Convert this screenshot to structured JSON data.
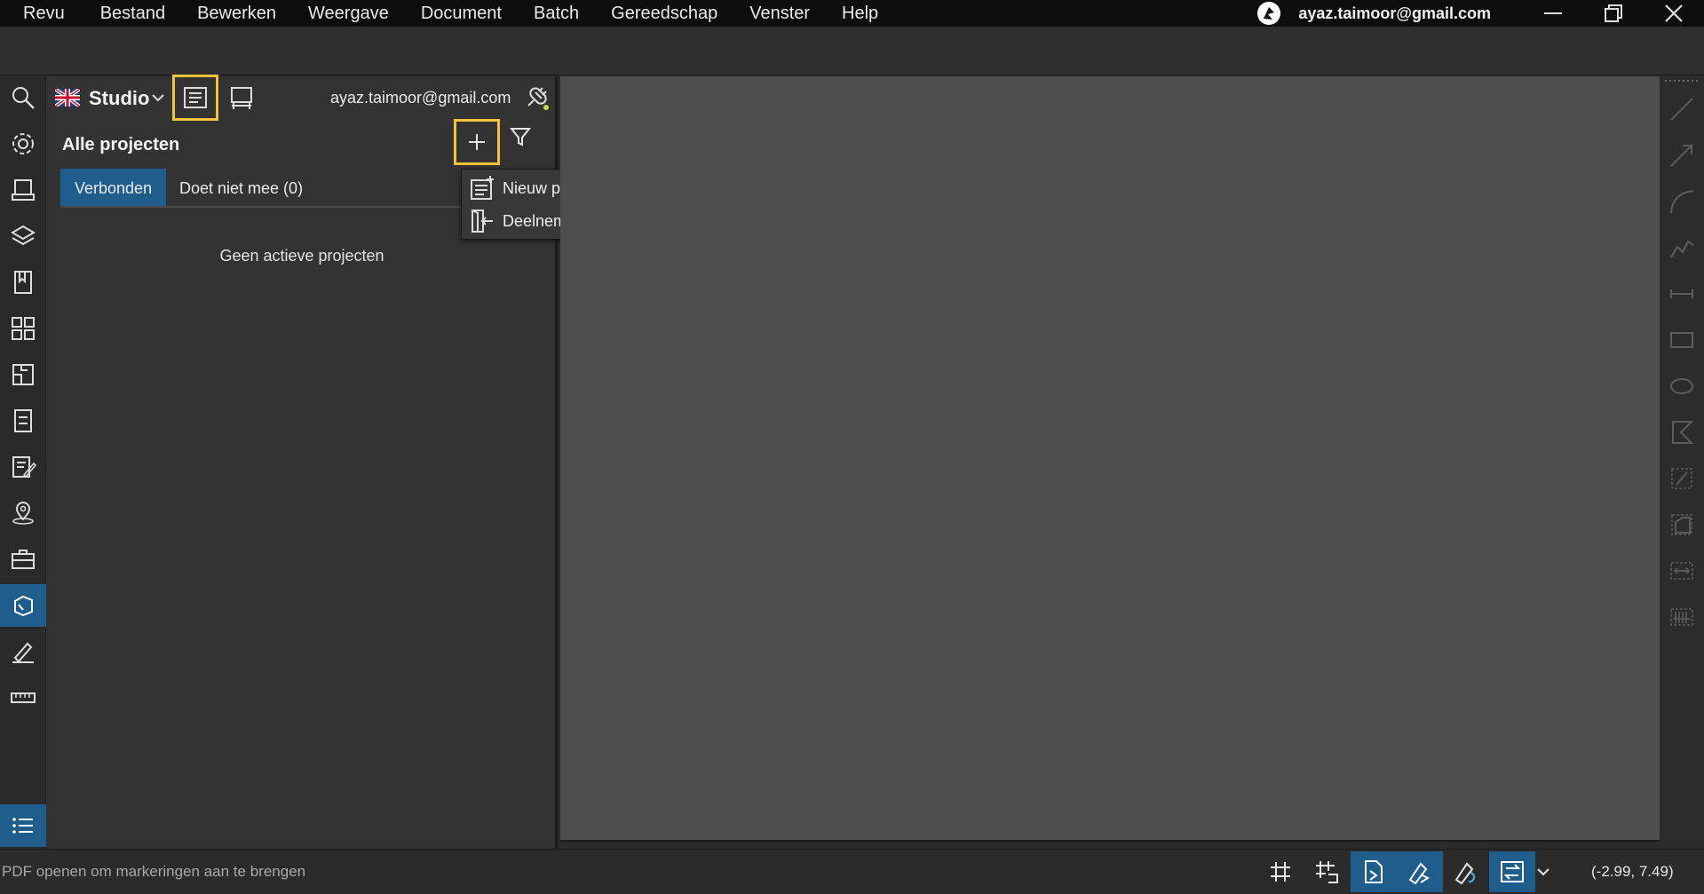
{
  "menubar": {
    "items": [
      "Revu",
      "Bestand",
      "Bewerken",
      "Weergave",
      "Document",
      "Batch",
      "Gereedschap",
      "Venster",
      "Help"
    ],
    "account_email": "ayaz.taimoor@gmail.com"
  },
  "rail": {
    "icons": [
      "search-icon",
      "settings-icon",
      "thumbnails-icon",
      "layers-icon",
      "bookmarks-icon",
      "grid-icon",
      "spaces-icon",
      "properties-icon",
      "markups-list-icon",
      "places-icon",
      "toolchest-icon",
      "studio-icon",
      "signatures-icon",
      "measurements-icon"
    ],
    "active": "studio-icon"
  },
  "panel": {
    "studio_label": "Studio",
    "email": "ayaz.taimoor@gmail.com",
    "title": "Alle projecten",
    "tabs": [
      {
        "label": "Verbonden",
        "active": true
      },
      {
        "label": "Doet niet mee (0)",
        "active": false
      }
    ],
    "empty_message": "Geen actieve projecten"
  },
  "dropdown": {
    "items": [
      {
        "label": "Nieuw project",
        "icon": "new-project-icon"
      },
      {
        "label": "Deelnemen",
        "icon": "join-icon"
      }
    ]
  },
  "statusbar": {
    "message": "PDF openen om markeringen aan te brengen",
    "coordinates": "(-2.99, 7.49)"
  },
  "colors": {
    "accent": "#1f5d8d",
    "highlight": "#f3c43a"
  }
}
